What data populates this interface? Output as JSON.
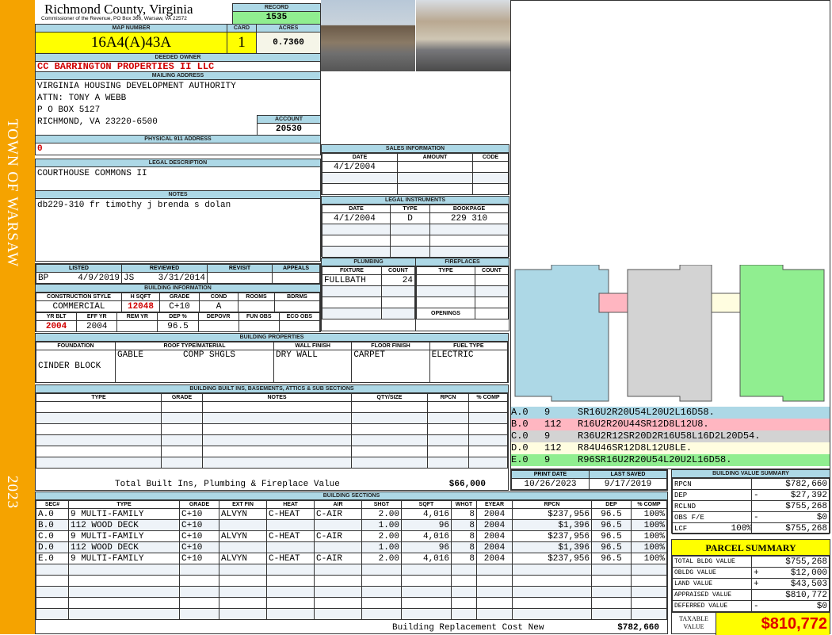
{
  "sidebar": {
    "town": "TOWN OF WARSAW",
    "year": "2023"
  },
  "header": {
    "county": "Richmond County, Virginia",
    "subtitle": "Commissioner of the Revenue, PO Box 366, Warsaw, VA 22572",
    "record_label": "RECORD",
    "record": "1535"
  },
  "parcel": {
    "map_label": "MAP NUMBER",
    "map_number": "16A4(A)43A",
    "card_label": "CARD",
    "card": "1",
    "acres_label": "ACRES",
    "acres": "0.7360"
  },
  "owner": {
    "label": "DEEDED OWNER",
    "name": "CC BARRINGTON PROPERTIES II LLC"
  },
  "mailing": {
    "label": "MAILING ADDRESS",
    "lines": [
      "VIRGINIA HOUSING DEVELOPMENT AUTHORITY",
      "ATTN: TONY A WEBB",
      "P O BOX 5127",
      "RICHMOND, VA 23220-6500"
    ],
    "account_label": "ACCOUNT",
    "account": "20530"
  },
  "physical": {
    "label": "PHYSICAL 911 ADDRESS",
    "value": "0"
  },
  "legal": {
    "label": "LEGAL DESCRIPTION",
    "value": "COURTHOUSE COMMONS II"
  },
  "notes": {
    "label": "NOTES",
    "value": "db229-310 fr timothy j brenda s dolan"
  },
  "sales": {
    "label": "SALES INFORMATION",
    "cols": [
      "DATE",
      "AMOUNT",
      "CODE"
    ],
    "rows": [
      [
        "4/1/2004",
        "",
        ""
      ]
    ]
  },
  "instruments": {
    "label": "LEGAL INSTRUMENTS",
    "cols": [
      "DATE",
      "TYPE",
      "BOOKPAGE"
    ],
    "rows": [
      [
        "4/1/2004",
        "D",
        "229 310"
      ]
    ]
  },
  "plumbing": {
    "label": "PLUMBING",
    "cols": [
      "FIXTURE",
      "COUNT"
    ],
    "rows": [
      [
        "FULLBATH",
        "24"
      ]
    ]
  },
  "fireplaces": {
    "label": "FIREPLACES",
    "cols": [
      "TYPE",
      "COUNT"
    ],
    "openings": "OPENINGS"
  },
  "listing": {
    "listed_label": "LISTED",
    "listed_by": "BP",
    "listed_date": "4/9/2019",
    "reviewed_label": "REVIEWED",
    "reviewed_by": "JS",
    "reviewed_date": "3/31/2014",
    "revisit_label": "REVISIT",
    "appeals_label": "APPEALS"
  },
  "building_info": {
    "label": "BUILDING INFORMATION",
    "cols1": [
      "CONSTRUCTION STYLE",
      "H SQFT",
      "GRADE",
      "COND",
      "ROOMS",
      "BDRMS"
    ],
    "style": "COMMERCIAL",
    "hsqft": "12048",
    "grade": "C+10",
    "cond": "A",
    "rooms": "",
    "bdrms": "",
    "cols2": [
      "YR BLT",
      "EFF YR",
      "REM YR",
      "DEP %",
      "DEPOVR",
      "FUN OBS",
      "ECO OBS"
    ],
    "yr_blt": "2004",
    "eff_yr": "2004",
    "rem_yr": "",
    "dep": "96.5"
  },
  "properties": {
    "label": "BUILDING PROPERTIES",
    "cols": [
      "FOUNDATION",
      "ROOF TYPE/MATERIAL",
      "WALL FINISH",
      "FLOOR FINISH",
      "FUEL TYPE"
    ],
    "foundation": "CINDER BLOCK",
    "roof_type": "GABLE",
    "roof_material": "COMP SHGLS",
    "wall": "DRY WALL",
    "floor": "CARPET",
    "fuel": "ELECTRIC"
  },
  "builtins": {
    "label": "BUILDING BUILT INS, BASEMENTS, ATTICS & SUB SECTIONS",
    "cols": [
      "TYPE",
      "GRADE",
      "NOTES",
      "QTY/SIZE",
      "RPCN",
      "% COMP"
    ],
    "total_label": "Total Built Ins, Plumbing & Fireplace Value",
    "total": "$66,000"
  },
  "sketch_legend": [
    {
      "sec": "A.0",
      "code": "9",
      "path": "SR16U2R20U54L20U2L16D58.",
      "color": "#add8e6"
    },
    {
      "sec": "B.0",
      "code": "112",
      "path": "R16U2R20U44SR12D8L12U8.",
      "color": "#ffb6c1"
    },
    {
      "sec": "C.0",
      "code": "9",
      "path": "R36U2R12SR20D2R16U58L16D2L20D54.",
      "color": "#d3d3d3"
    },
    {
      "sec": "D.0",
      "code": "112",
      "path": "R84U46SR12D8L12U8LE.",
      "color": "#fffde0"
    },
    {
      "sec": "E.0",
      "code": "9",
      "path": "R96SR16U2R20U54L20U2L16D58.",
      "color": "#90ee90"
    }
  ],
  "dates": {
    "print_label": "PRINT DATE",
    "print": "10/26/2023",
    "saved_label": "LAST SAVED",
    "saved": "9/17/2019"
  },
  "sections": {
    "label": "BUILDING SECTIONS",
    "cols": [
      "SEC#",
      "TYPE",
      "GRADE",
      "EXT FIN",
      "HEAT",
      "AIR",
      "SHGT",
      "SQFT",
      "WHGT",
      "EYEAR",
      "RPCN",
      "DEP",
      "% COMP"
    ],
    "rows": [
      [
        "A.0",
        "9 MULTI-FAMILY",
        "C+10",
        "ALVYN",
        "C-HEAT",
        "C-AIR",
        "2.00",
        "4,016",
        "8",
        "2004",
        "$237,956",
        "96.5",
        "100%"
      ],
      [
        "B.0",
        "112 WOOD DECK",
        "C+10",
        "",
        "",
        "",
        "1.00",
        "96",
        "8",
        "2004",
        "$1,396",
        "96.5",
        "100%"
      ],
      [
        "C.0",
        "9 MULTI-FAMILY",
        "C+10",
        "ALVYN",
        "C-HEAT",
        "C-AIR",
        "2.00",
        "4,016",
        "8",
        "2004",
        "$237,956",
        "96.5",
        "100%"
      ],
      [
        "D.0",
        "112 WOOD DECK",
        "C+10",
        "",
        "",
        "",
        "1.00",
        "96",
        "8",
        "2004",
        "$1,396",
        "96.5",
        "100%"
      ],
      [
        "E.0",
        "9 MULTI-FAMILY",
        "C+10",
        "ALVYN",
        "C-HEAT",
        "C-AIR",
        "2.00",
        "4,016",
        "8",
        "2004",
        "$237,956",
        "96.5",
        "100%"
      ]
    ],
    "total_label": "Building Replacement Cost New",
    "total": "$782,660"
  },
  "value_summary": {
    "label": "BUILDING VALUE SUMMARY",
    "rows": [
      {
        "name": "RPCN",
        "sign": "",
        "value": "$782,660"
      },
      {
        "name": "DEP",
        "sign": "-",
        "value": "$27,392"
      },
      {
        "name": "RCLND",
        "sign": "",
        "value": "$755,268"
      },
      {
        "name": "OBS F/E",
        "sign": "-",
        "value": "$0"
      },
      {
        "name": "LCF",
        "pct": "100%",
        "sign": "",
        "value": "$755,268"
      }
    ]
  },
  "parcel_summary": {
    "label": "PARCEL SUMMARY",
    "rows": [
      {
        "name": "TOTAL BLDG VALUE",
        "sign": "",
        "value": "$755,268"
      },
      {
        "name": "OBLDG VALUE",
        "sign": "+",
        "value": "$12,000"
      },
      {
        "name": "LAND VALUE",
        "sign": "+",
        "value": "$43,503"
      },
      {
        "name": "APPRAISED VALUE",
        "sign": "",
        "value": "$810,772"
      },
      {
        "name": "DEFERRED VALUE",
        "sign": "-",
        "value": "$0"
      }
    ],
    "taxable_label": "TAXABLE VALUE",
    "taxable": "$810,772"
  }
}
